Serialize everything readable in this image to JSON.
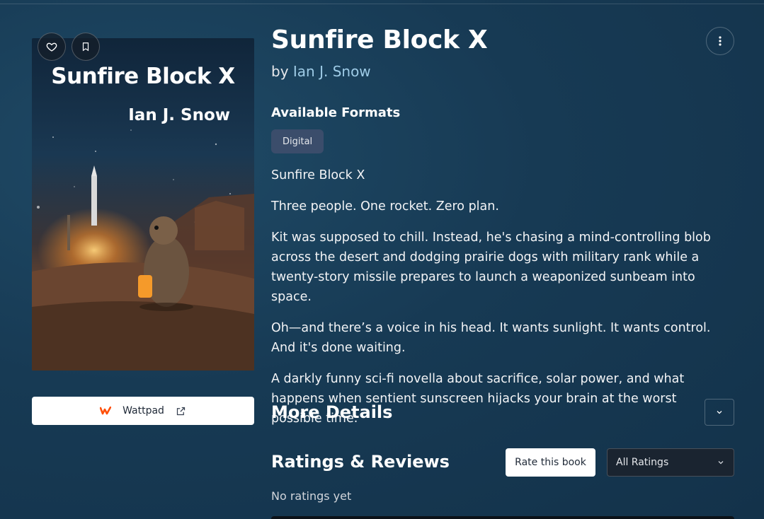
{
  "book": {
    "title": "Sunfire Block X",
    "by_label": "by",
    "author": "Ian J. Snow",
    "cover": {
      "title": "Sunfire Block X",
      "author": "Ian J. Snow"
    }
  },
  "actions": {
    "favorite_icon": "heart-icon",
    "bookmark_icon": "bookmark-icon",
    "more_icon": "more-vertical-icon"
  },
  "formats": {
    "heading": "Available Formats",
    "items": [
      "Digital"
    ]
  },
  "description": [
    "Sunfire Block X",
    "Three people. One rocket. Zero plan.",
    "Kit was supposed to chill. Instead, he's chasing a mind-controlling blob across the desert and dodging prairie dogs with military rank while a twenty-story missile prepares to launch a weaponized sunbeam into space.",
    "Oh—and there’s a voice in his head. It wants sunlight. It wants control. And it's done waiting.",
    "A darkly funny sci-fi novella about sacrifice, solar power, and what happens when sentient sunscreen hijacks your brain at the worst possible time."
  ],
  "store_link": {
    "label": "Wattpad",
    "logo_color": "#ff500a"
  },
  "more_details": {
    "heading": "More Details"
  },
  "ratings": {
    "heading": "Ratings & Reviews",
    "rate_label": "Rate this book",
    "filter_value": "All Ratings",
    "empty_text": "No ratings yet"
  }
}
